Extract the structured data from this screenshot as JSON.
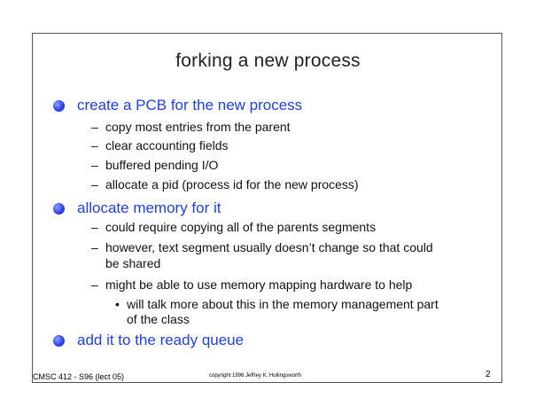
{
  "slide": {
    "title": "forking a new process",
    "bullets": [
      {
        "text": "create a PCB for the new process",
        "subs": [
          "copy most entries from the parent",
          "clear accounting fields",
          "buffered pending I/O",
          "allocate a pid (process id for the new process)"
        ]
      },
      {
        "text": "allocate memory for it",
        "subs": [
          "could require copying all of the parents segments",
          "however, text segment usually doesn’t change so that could",
          "be shared",
          "might be able to use memory mapping hardware to help"
        ],
        "subsubs": [
          "will talk more about this in the memory management part",
          "of the class"
        ]
      },
      {
        "text": "add it to the ready queue"
      }
    ],
    "dash_symbol": "–",
    "dot_symbol": "•"
  },
  "footer": {
    "left": "CMSC 412 - S96 (lect 05)",
    "center": "copyright 1996 Jeffrey K. Hollingsworth",
    "page_number": "2"
  }
}
